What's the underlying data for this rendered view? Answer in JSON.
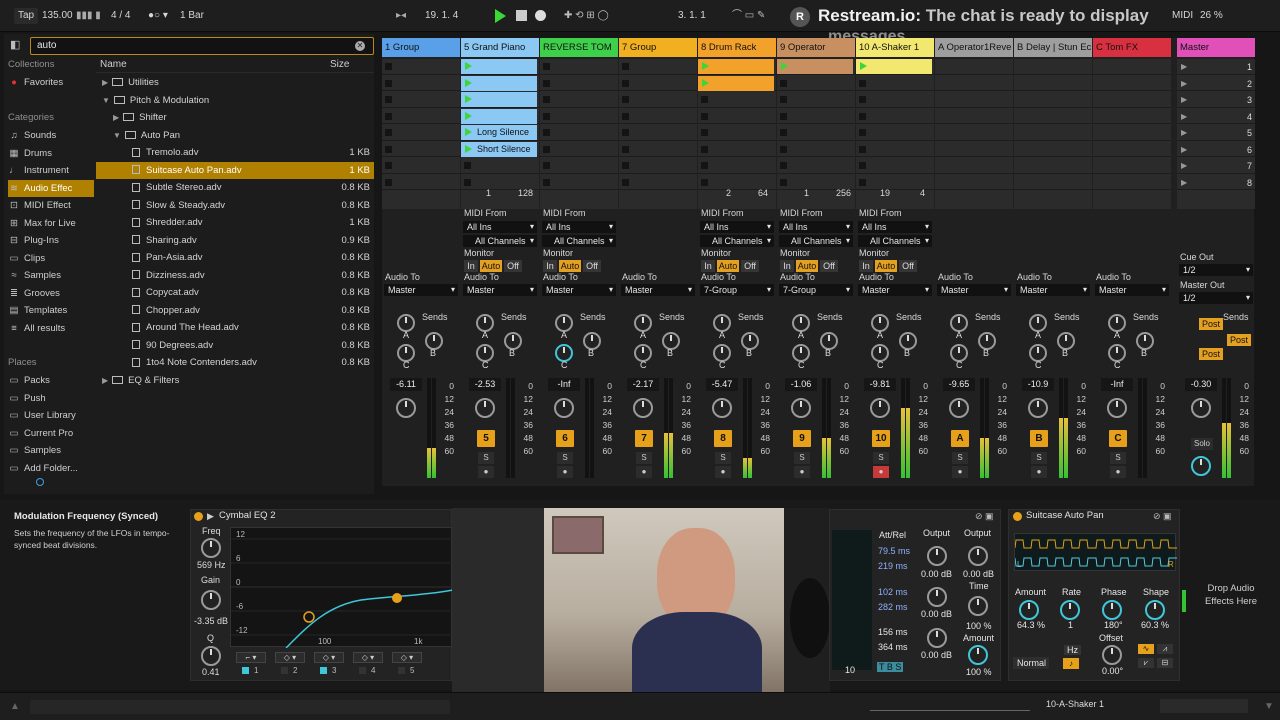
{
  "transport": {
    "tap": "Tap",
    "tempo": "135.00",
    "signature": "4 / 4",
    "quantize": "1 Bar",
    "position": "19.  1.  4",
    "loop_start": "3.  1.  1",
    "cpu": "26 %",
    "midi": "MIDI"
  },
  "overlay": {
    "r": "R",
    "brand": "Restream.io:",
    "message": "The chat is ready to display",
    "message2": "messages."
  },
  "browser": {
    "search_value": "auto",
    "collections_header": "Collections",
    "favorites": "Favorites",
    "categories_header": "Categories",
    "categories": [
      "Sounds",
      "Drums",
      "Instrument",
      "Audio Effec",
      "MIDI Effect",
      "Max for Live",
      "Plug-Ins",
      "Clips",
      "Samples",
      "Grooves",
      "Templates",
      "All results"
    ],
    "places_header": "Places",
    "places": [
      "Packs",
      "Push",
      "User Library",
      "Current Pro",
      "Samples",
      "Add Folder..."
    ],
    "name_col": "Name",
    "size_col": "Size",
    "files": [
      {
        "name": "Utilities",
        "size": "",
        "type": "folder",
        "indent": 0
      },
      {
        "name": "Pitch & Modulation",
        "size": "",
        "type": "folder",
        "indent": 0
      },
      {
        "name": "Shifter",
        "size": "",
        "type": "folder",
        "indent": 1
      },
      {
        "name": "Auto Pan",
        "size": "",
        "type": "folder",
        "indent": 1
      },
      {
        "name": "Tremolo.adv",
        "size": "1 KB",
        "type": "file",
        "indent": 2
      },
      {
        "name": "Suitcase Auto Pan.adv",
        "size": "1 KB",
        "type": "file",
        "indent": 2
      },
      {
        "name": "Subtle Stereo.adv",
        "size": "0.8 KB",
        "type": "file",
        "indent": 2
      },
      {
        "name": "Slow & Steady.adv",
        "size": "0.8 KB",
        "type": "file",
        "indent": 2
      },
      {
        "name": "Shredder.adv",
        "size": "1 KB",
        "type": "file",
        "indent": 2
      },
      {
        "name": "Sharing.adv",
        "size": "0.9 KB",
        "type": "file",
        "indent": 2
      },
      {
        "name": "Pan-Asia.adv",
        "size": "0.8 KB",
        "type": "file",
        "indent": 2
      },
      {
        "name": "Dizziness.adv",
        "size": "0.8 KB",
        "type": "file",
        "indent": 2
      },
      {
        "name": "Copycat.adv",
        "size": "0.8 KB",
        "type": "file",
        "indent": 2
      },
      {
        "name": "Chopper.adv",
        "size": "0.8 KB",
        "type": "file",
        "indent": 2
      },
      {
        "name": "Around The Head.adv",
        "size": "0.8 KB",
        "type": "file",
        "indent": 2
      },
      {
        "name": "90 Degrees.adv",
        "size": "0.8 KB",
        "type": "file",
        "indent": 2
      },
      {
        "name": "1to4 Note Contenders.adv",
        "size": "0.8 KB",
        "type": "file",
        "indent": 2
      },
      {
        "name": "EQ & Filters",
        "size": "",
        "type": "folder",
        "indent": 0
      }
    ]
  },
  "tracks": [
    {
      "name": "1 Group",
      "color": "#5aa0e8",
      "num": "",
      "vol": "-6.11",
      "audio_to": "Master"
    },
    {
      "name": "5 Grand Piano",
      "color": "#8cc8f4",
      "num": "5",
      "vol": "-2.53",
      "audio_to": "Master",
      "midi": true
    },
    {
      "name": "REVERSE TOM",
      "color": "#3ed04a",
      "num": "6",
      "vol": "-Inf",
      "audio_to": "Master",
      "midi": true
    },
    {
      "name": "7 Group",
      "color": "#f0b020",
      "num": "7",
      "vol": "-2.17",
      "audio_to": "Master"
    },
    {
      "name": "8 Drum Rack",
      "color": "#f2a22a",
      "num": "8",
      "vol": "-5.47",
      "audio_to": "7-Group",
      "midi": true
    },
    {
      "name": "9 Operator",
      "color": "#c89060",
      "num": "9",
      "vol": "-1.06",
      "audio_to": "7-Group",
      "midi": true
    },
    {
      "name": "10 A-Shaker 1",
      "color": "#f2e870",
      "num": "10",
      "vol": "-9.81",
      "audio_to": "Master",
      "midi": true
    },
    {
      "name": "A Operator1Reve",
      "color": "#9e9e9e",
      "num": "A",
      "vol": "-9.65",
      "audio_to": "Master"
    },
    {
      "name": "B Delay | Stun Ec",
      "color": "#9e9e9e",
      "num": "B",
      "vol": "-10.9",
      "audio_to": "Master"
    },
    {
      "name": "C Tom FX",
      "color": "#d83040",
      "num": "C",
      "vol": "-Inf",
      "audio_to": "Master"
    },
    {
      "name": "Master",
      "color": "#e050b8",
      "num": "",
      "vol": "-0.30",
      "audio_to": ""
    }
  ],
  "clips": {
    "long_silence": "Long Silence",
    "short_silence": "Short Silence"
  },
  "clip_counts": [
    "1",
    "128",
    "2",
    "64",
    "1",
    "256",
    "19",
    "4"
  ],
  "io": {
    "midi_from": "MIDI From",
    "all_ins": "All Ins",
    "all_channels": "All Channels",
    "monitor": "Monitor",
    "in": "In",
    "auto": "Auto",
    "off": "Off",
    "audio_to": "Audio To",
    "sends": "Sends",
    "a": "A",
    "b": "B",
    "c": "C",
    "cue_out": "Cue Out",
    "cue_val": "1/2",
    "master_out": "Master Out",
    "master_val": "1/2",
    "post": "Post",
    "solo": "Solo",
    "s": "S"
  },
  "scale": [
    "0",
    "12",
    "24",
    "36",
    "48",
    "60"
  ],
  "scenes": [
    "1",
    "2",
    "3",
    "4",
    "5",
    "6",
    "7",
    "8"
  ],
  "info": {
    "title": "Modulation Frequency (Synced)",
    "text": "Sets the frequency of the LFOs in tempo-synced beat divisions."
  },
  "eq": {
    "title": "Cymbal EQ 2",
    "freq_label": "Freq",
    "freq_val": "569 Hz",
    "gain_label": "Gain",
    "gain_val": "-3.35 dB",
    "q_label": "Q",
    "q_val": "0.41",
    "ticks": [
      "12",
      "6",
      "0",
      "-6",
      "-12"
    ],
    "x100": "100",
    "x1k": "1k",
    "bands": [
      "1",
      "2",
      "3",
      "4",
      "5"
    ]
  },
  "delay": {
    "attrel": "Att/Rel",
    "v1": "79.5 ms",
    "v2": "219 ms",
    "v3": "102 ms",
    "v4": "282 ms",
    "v5": "156 ms",
    "v6": "364 ms",
    "output1": "Output",
    "output2": "Output",
    "o1": "0.00 dB",
    "o2": "0.00 dB",
    "o3": "0.00 dB",
    "o4": "0.00 dB",
    "time": "Time",
    "time_val": "100 %",
    "amount": "Amount",
    "amount_val": "100 %",
    "ten": "10",
    "tbs": "T B S"
  },
  "autopan": {
    "title": "Suitcase Auto Pan",
    "amount_label": "Amount",
    "amount_val": "64.3 %",
    "rate_label": "Rate",
    "rate_val": "1",
    "phase_label": "Phase",
    "phase_val": "180°",
    "shape_label": "Shape",
    "shape_val": "60.3 %",
    "offset_label": "Offset",
    "offset_val": "0.00°",
    "hz": "Hz",
    "normal": "Normal",
    "wave_l": "L",
    "wave_r": "R"
  },
  "drop_fx": "Drop Audio Effects Here",
  "status_track": "10-A-Shaker 1"
}
